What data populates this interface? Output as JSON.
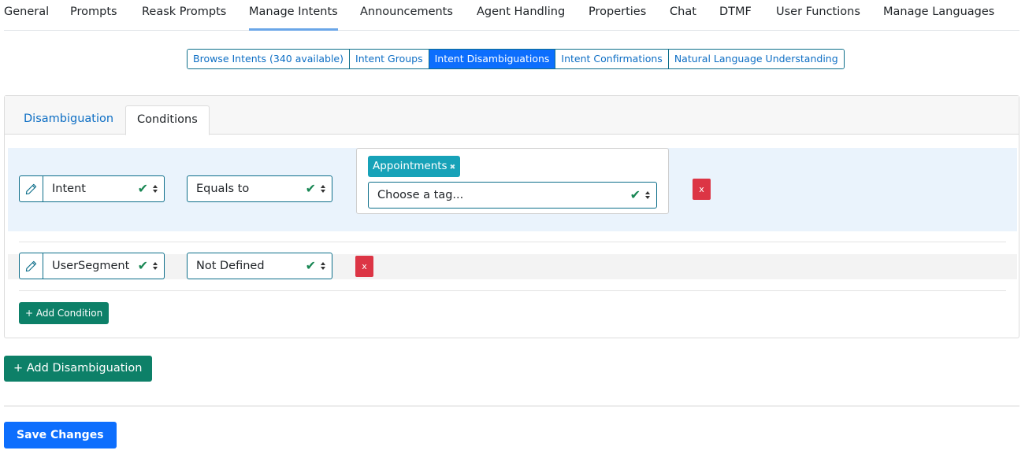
{
  "top_nav": {
    "items": [
      {
        "label": "General"
      },
      {
        "label": "Prompts"
      },
      {
        "label": "Reask Prompts"
      },
      {
        "label": "Manage Intents"
      },
      {
        "label": "Announcements"
      },
      {
        "label": "Agent Handling"
      },
      {
        "label": "Properties"
      },
      {
        "label": "Chat"
      },
      {
        "label": "DTMF"
      },
      {
        "label": "User Functions"
      },
      {
        "label": "Manage Languages"
      }
    ],
    "active": "Manage Intents"
  },
  "sub_nav": {
    "items": [
      {
        "label": "Browse Intents (340 available)"
      },
      {
        "label": "Intent Groups"
      },
      {
        "label": "Intent Disambiguations"
      },
      {
        "label": "Intent Confirmations"
      },
      {
        "label": "Natural Language Understanding"
      }
    ],
    "active": "Intent Disambiguations"
  },
  "card": {
    "tabs": [
      {
        "label": "Disambiguation"
      },
      {
        "label": "Conditions"
      }
    ],
    "active_tab": "Conditions",
    "conditions": [
      {
        "field": "Intent",
        "operator": "Equals to",
        "tags": [
          "Appointments"
        ],
        "tag_placeholder": "Choose a tag...",
        "delete_label": "x"
      },
      {
        "field": "UserSegment",
        "operator": "Not Defined",
        "delete_label": "x"
      }
    ],
    "add_condition_label": "+ Add Condition"
  },
  "add_disambiguation_label": "+ Add Disambiguation",
  "save_label": "Save Changes",
  "colors": {
    "primary": "#0d6efd",
    "success": "#0d8068",
    "danger": "#dc3545",
    "tag": "#17a2b8",
    "link": "#0d6ec4"
  }
}
